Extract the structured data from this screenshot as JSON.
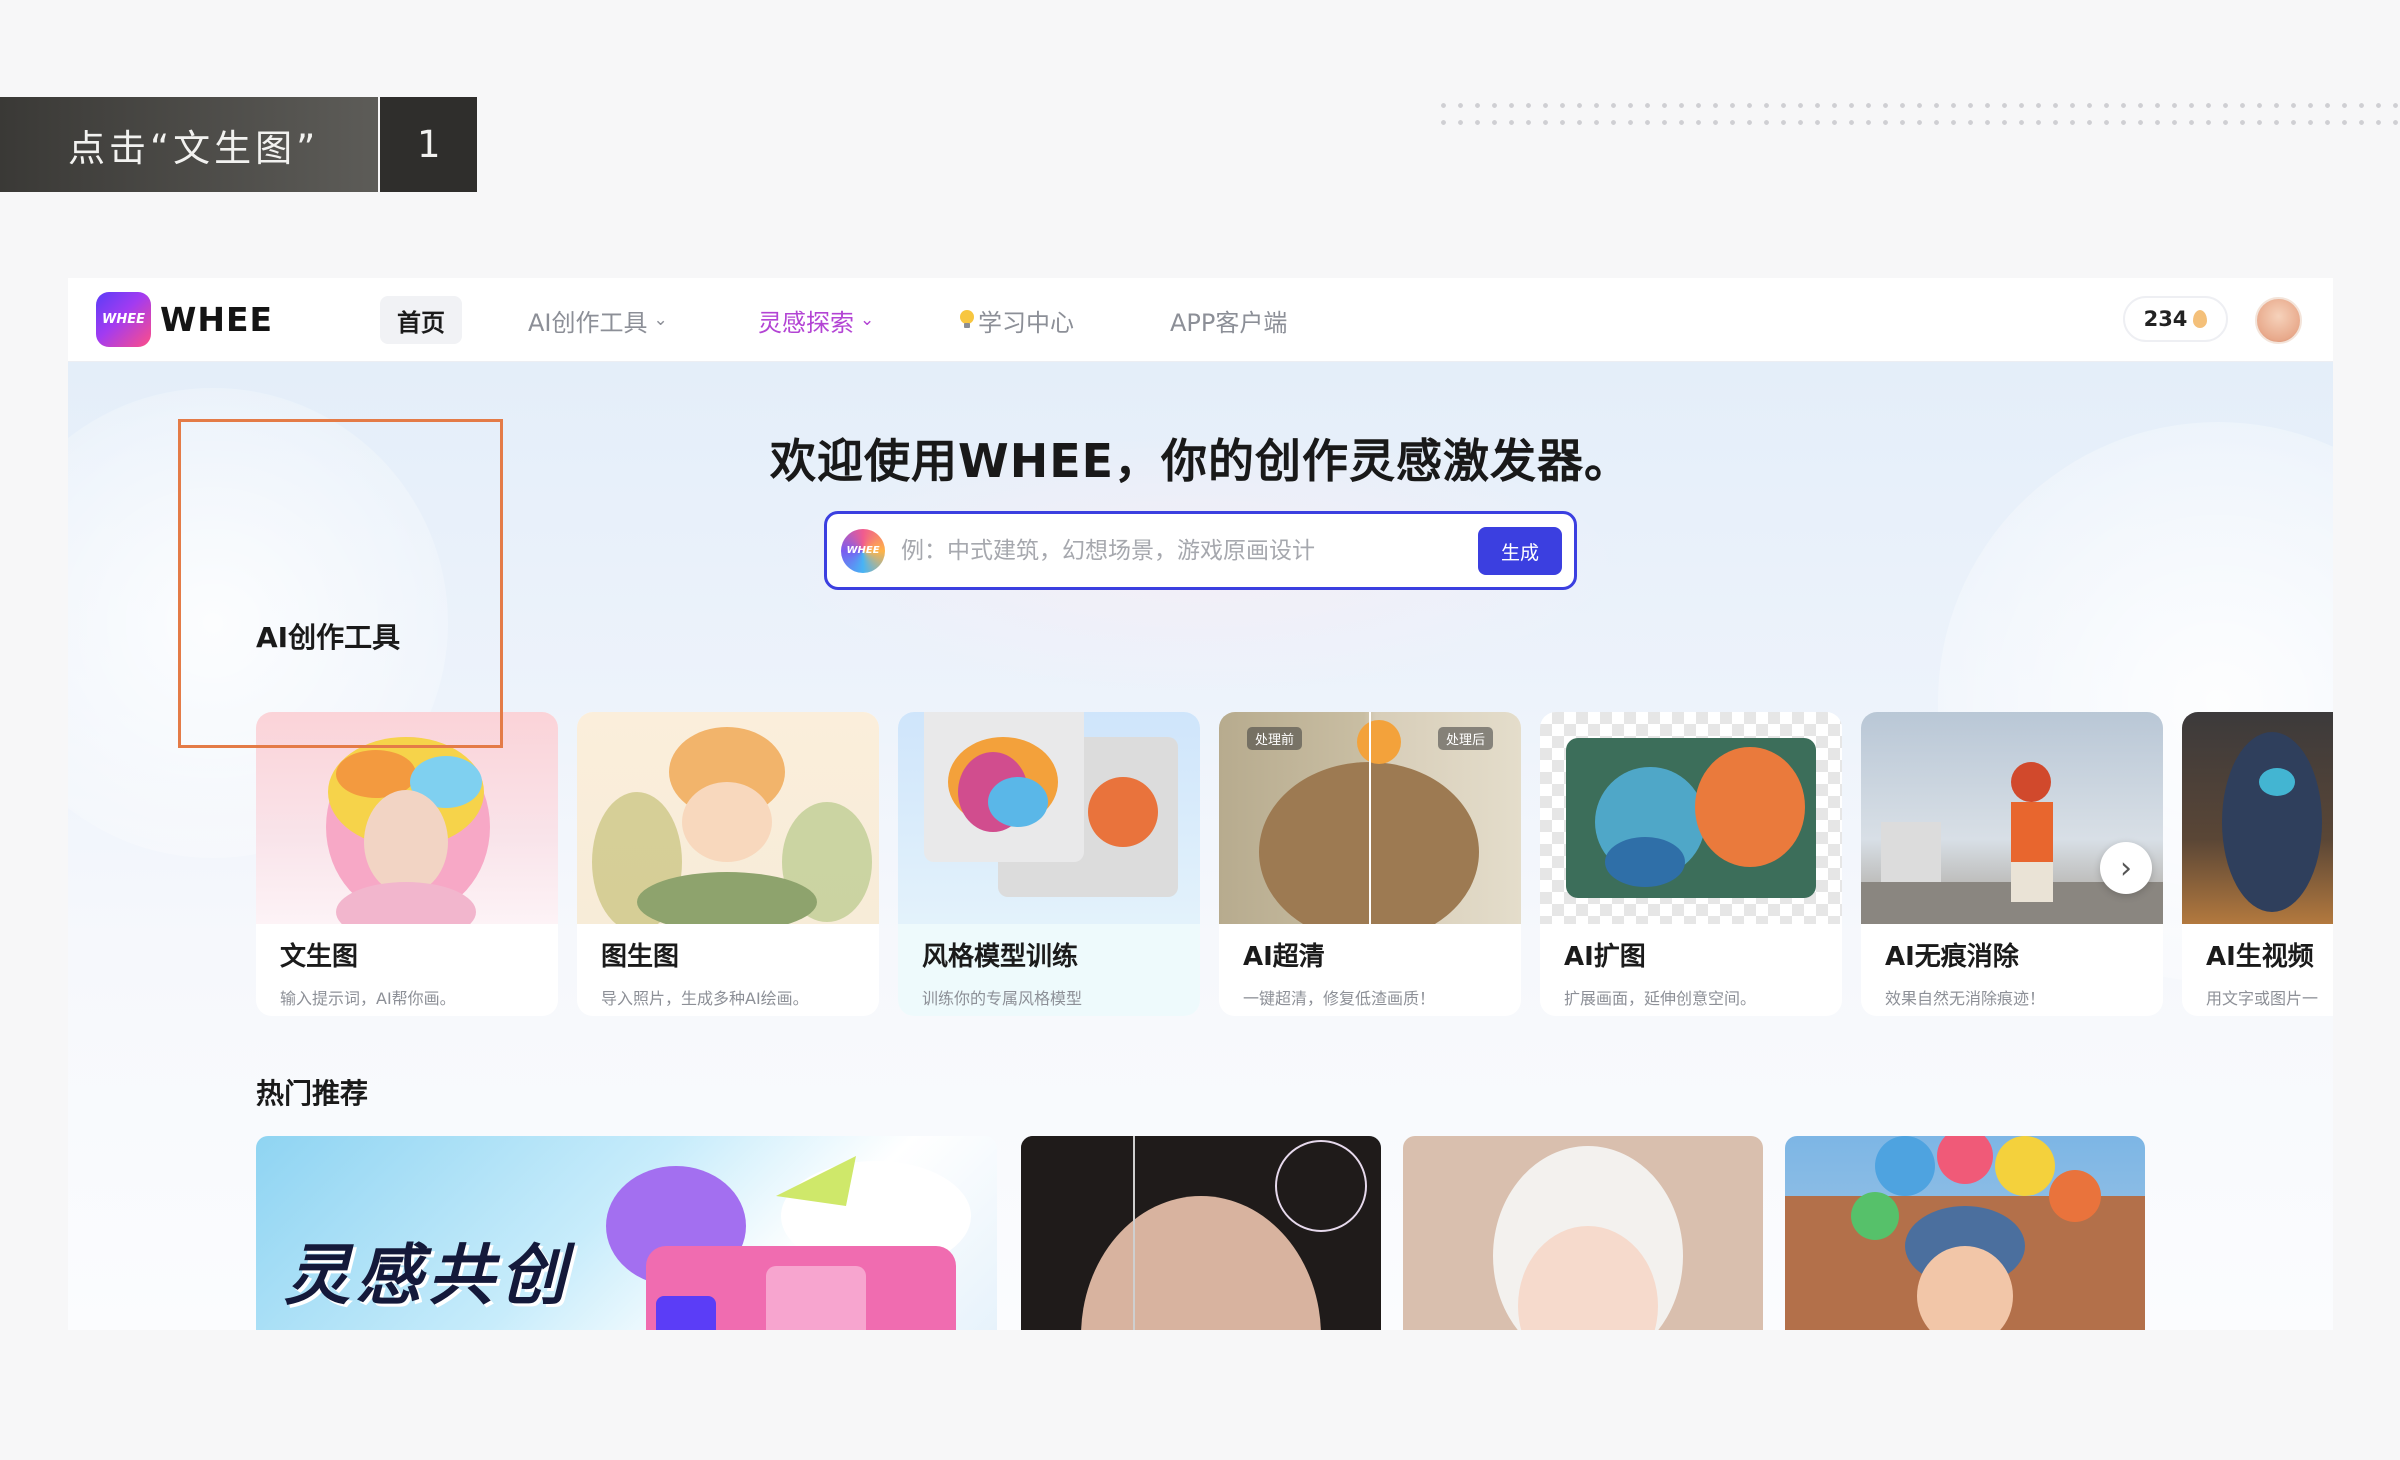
{
  "instruction": {
    "label": "点击“文生图”",
    "step": "1"
  },
  "app": {
    "logo_text": "WHEE",
    "logo_mark": "WHEE",
    "nav": {
      "home": "首页",
      "tools": "AI创作工具",
      "inspiration": "灵感探索",
      "learn": "学习中心",
      "app_client": "APP客户端"
    },
    "credits": "234",
    "hero_title": "欢迎使用WHEE，你的创作灵感激发器。",
    "search": {
      "placeholder": "例：中式建筑，幻想场景，游戏原画设计",
      "button": "生成"
    },
    "tools_section_title": "AI创作工具",
    "tools": [
      {
        "title": "文生图",
        "desc": "输入提示词，AI帮你画。"
      },
      {
        "title": "图生图",
        "desc": "导入照片，生成多种AI绘画。"
      },
      {
        "title": "风格模型训练",
        "desc": "训练你的专属风格模型"
      },
      {
        "title": "AI超清",
        "desc": "一键超清，修复低渣画质！",
        "badge_before": "处理前",
        "badge_after": "处理后"
      },
      {
        "title": "AI扩图",
        "desc": "扩展画面，延伸创意空间。"
      },
      {
        "title": "AI无痕消除",
        "desc": "效果自然无消除痕迹！"
      },
      {
        "title": "AI生视频",
        "desc": "用文字或图片一"
      }
    ],
    "hot_section_title": "热门推荐",
    "banner_text": "灵感共创"
  },
  "colors": {
    "accent": "#3b3fe0",
    "highlight_frame": "#e47b47",
    "inspiration_nav": "#b344d4"
  },
  "icons": [
    "chevron-down-icon",
    "lightbulb-icon",
    "egg-icon",
    "avatar",
    "chevron-right-icon"
  ]
}
